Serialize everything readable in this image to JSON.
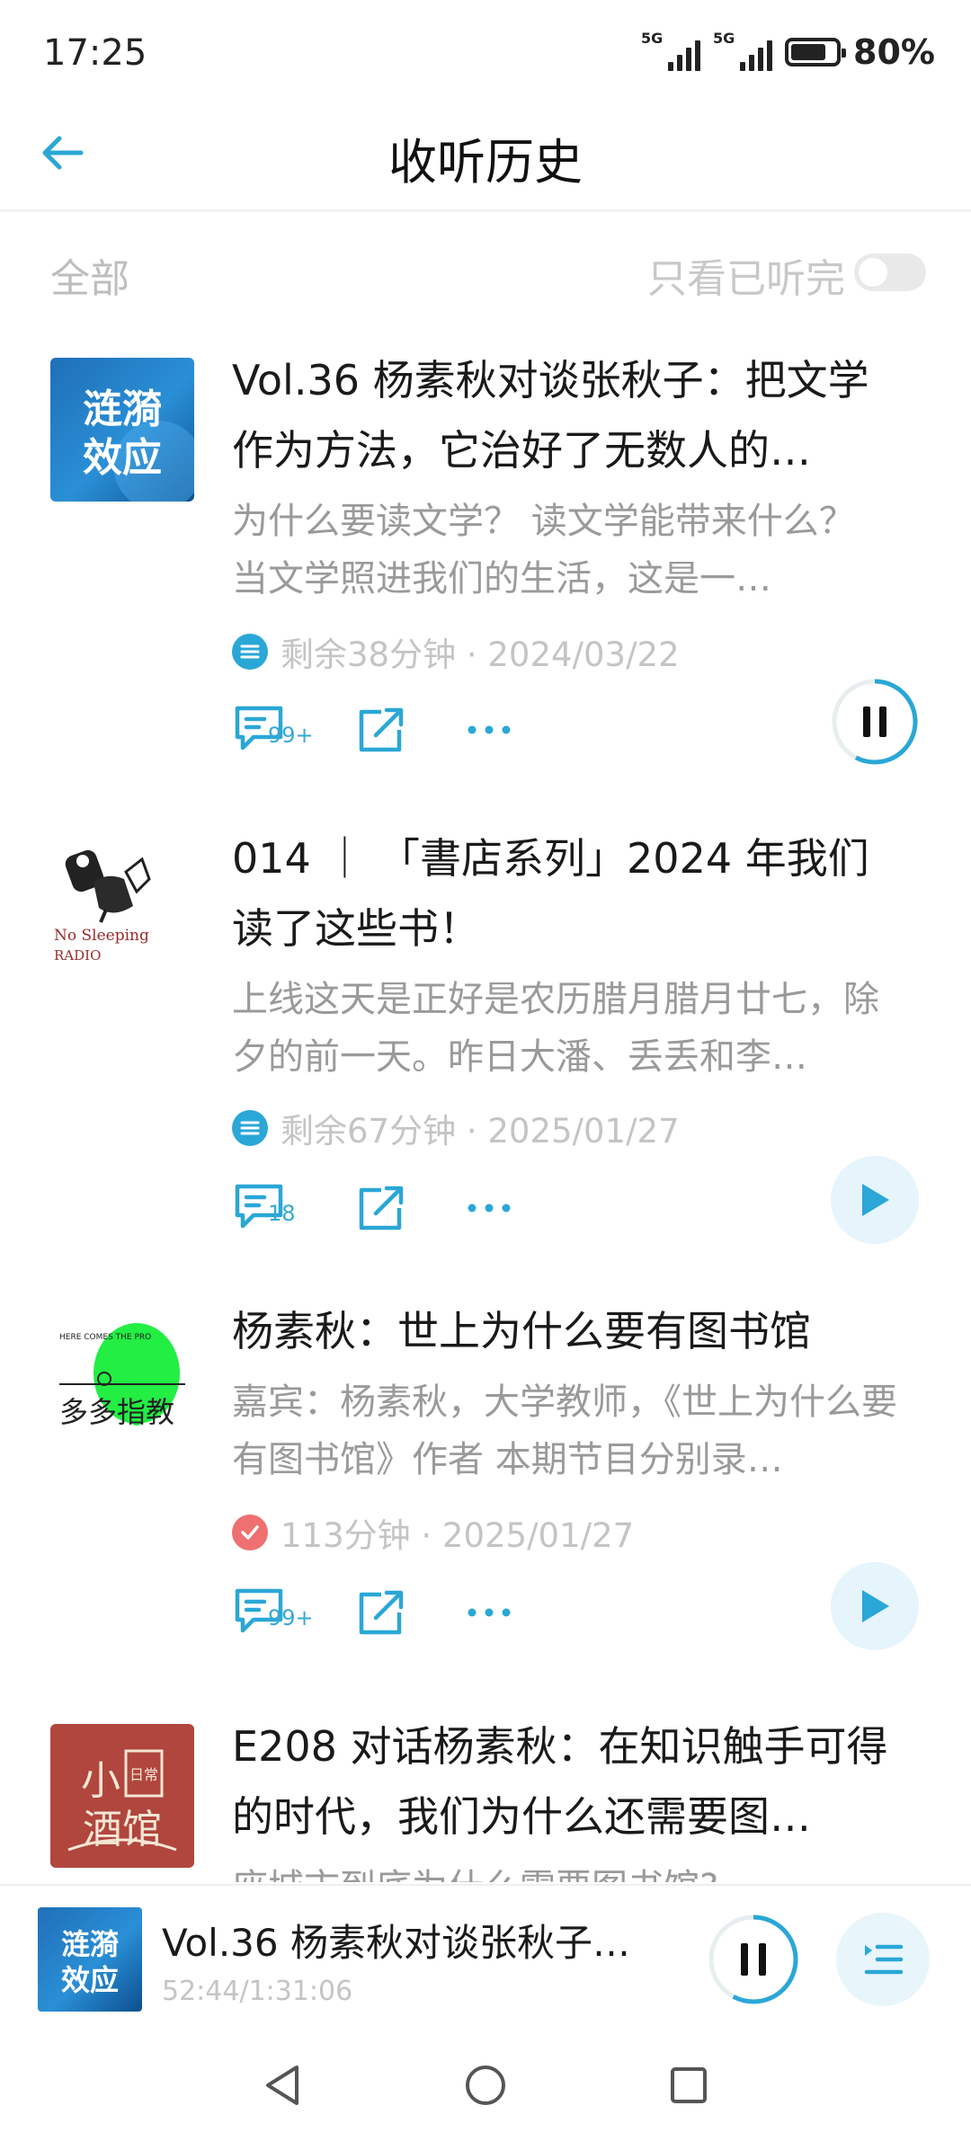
{
  "status_bar": {
    "time": "17:25",
    "network_1": "5G",
    "network_2": "5G",
    "battery": "80%",
    "battery_level": 0.8
  },
  "header": {
    "title": "收听历史",
    "back_icon": "arrow-left-icon"
  },
  "filter": {
    "all_label": "全部",
    "finished_only_label": "只看已听完",
    "finished_only_enabled": false
  },
  "episodes": [
    {
      "cover_text": "涟漪效应",
      "title": "Vol.36 杨素秋对谈张秋子：把文学作为方法，它治好了无数人的…",
      "description": "为什么要读文学？ 读文学能带来什么？ 当文学照进我们的生活，这是一…",
      "meta_icon": "list-icon",
      "meta": "剩余38分钟 · 2024/03/22",
      "comments": "99+",
      "state": "playing"
    },
    {
      "cover_text": "No Sleeping RADIO",
      "title": "014 ｜ 「書店系列」2024 年我们读了这些书！",
      "description": "上线这天是正好是农历腊月腊月廿七，除夕的前一天。昨日大潘、丢丢和李…",
      "meta_icon": "list-icon",
      "meta": "剩余67分钟 · 2025/01/27",
      "comments": "18",
      "state": "paused"
    },
    {
      "cover_text": "多多指教",
      "cover_small_text": "HERE COMES THE PRO",
      "title": "杨素秋：世上为什么要有图书馆",
      "description": "嘉宾：杨素秋，大学教师，《世上为什么要有图书馆》作者 本期节目分别录…",
      "meta_icon": "check-circle-icon",
      "meta": "113分钟 · 2025/01/27",
      "comments": "99+",
      "state": "paused"
    },
    {
      "cover_text_1": "小",
      "cover_text_2": "酒馆",
      "cover_text_3": "日常",
      "title": "E208 对话杨素秋：在知识触手可得的时代，我们为什么还需要图…",
      "description": "座城市到底为什么需要图书馆?"
    }
  ],
  "mini_player": {
    "title": "Vol.36 杨素秋对谈张秋子：…",
    "time": "52:44/1:31:06",
    "progress": 0.578
  },
  "colors": {
    "accent": "#2aa7d6",
    "play_bg": "#e6f4fb",
    "check_red": "#ee7070"
  }
}
